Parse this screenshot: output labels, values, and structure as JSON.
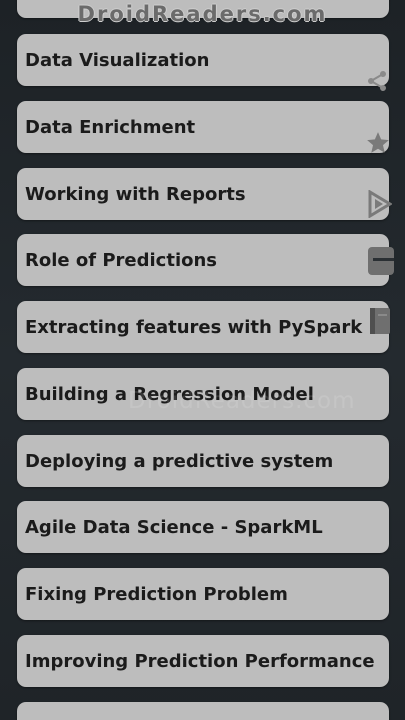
{
  "watermark": {
    "top_text": "DroidReaders.com",
    "mid_text": "DroidReaders.com"
  },
  "menu": {
    "items": [
      {
        "label": ""
      },
      {
        "label": "Data Visualization"
      },
      {
        "label": "Data Enrichment"
      },
      {
        "label": "Working with Reports"
      },
      {
        "label": "Role of Predictions"
      },
      {
        "label": "Extracting features with PySpark"
      },
      {
        "label": "Building a Regression Model"
      },
      {
        "label": "Deploying a predictive system"
      },
      {
        "label": "Agile Data Science - SparkML"
      },
      {
        "label": "Fixing Prediction Problem"
      },
      {
        "label": "Improving Prediction Performance"
      },
      {
        "label": ""
      }
    ]
  },
  "side_icons": [
    "share-icon",
    "star-icon",
    "play-icon",
    "ebook-icon",
    "book-icon"
  ]
}
